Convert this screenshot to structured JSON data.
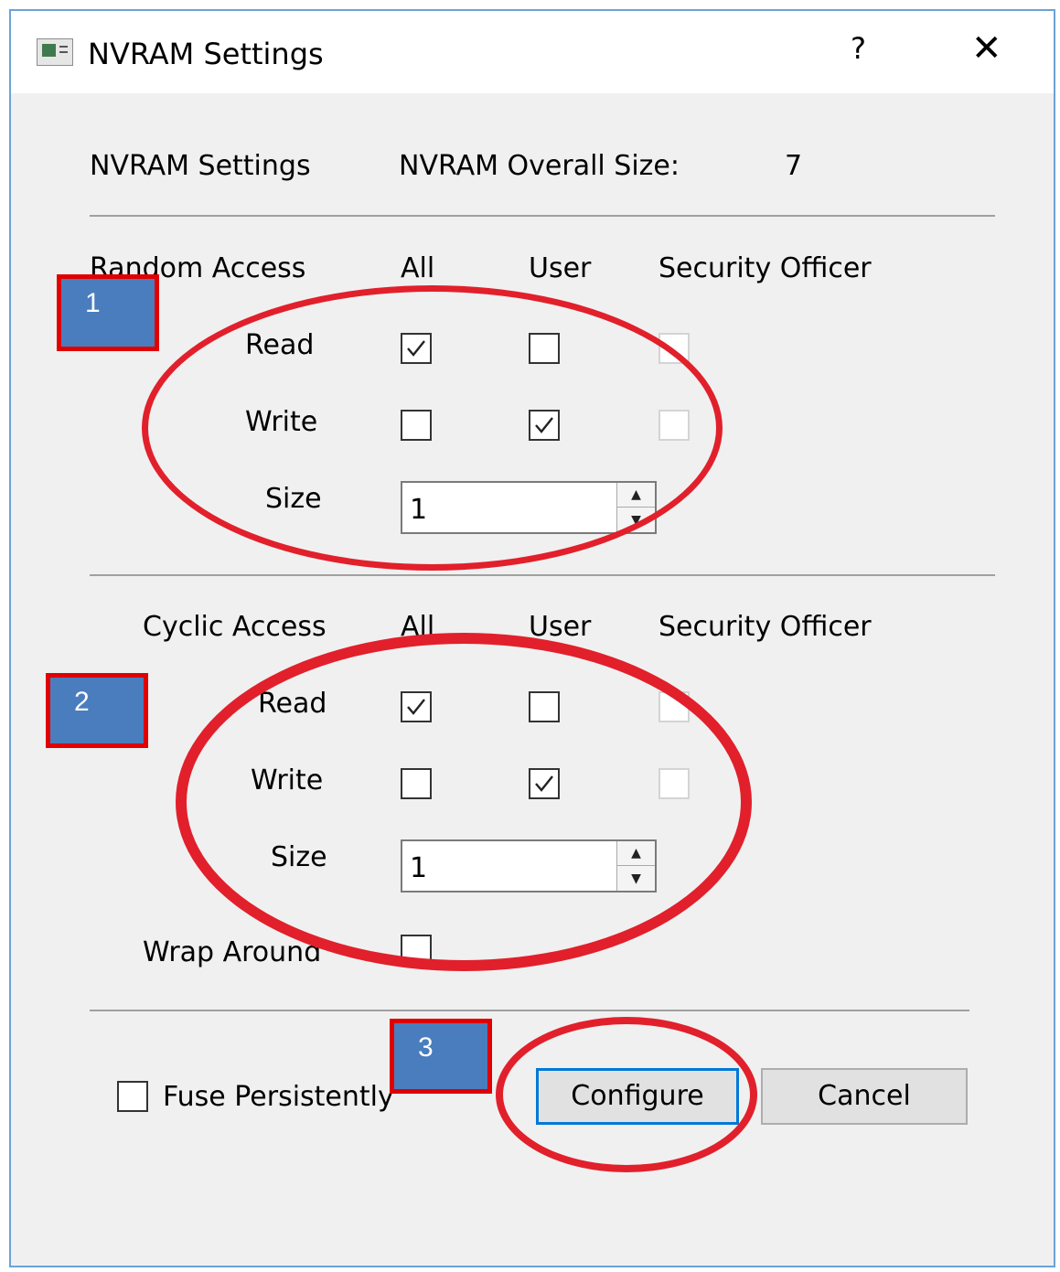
{
  "window": {
    "title": "NVRAM Settings",
    "help_icon": "?",
    "close_icon": "✕"
  },
  "header": {
    "settings_label": "NVRAM Settings",
    "overall_size_label": "NVRAM Overall Size:",
    "overall_size_value": "7"
  },
  "random_access": {
    "heading": "Random Access",
    "col_all": "All",
    "col_user": "User",
    "col_security_officer": "Security Officer",
    "read_label": "Read",
    "write_label": "Write",
    "size_label": "Size",
    "size_value": "1",
    "read": {
      "all": true,
      "user": false,
      "security_officer": false
    },
    "write": {
      "all": false,
      "user": true,
      "security_officer": false
    }
  },
  "cyclic_access": {
    "heading": "Cyclic Access",
    "col_all": "All",
    "col_user": "User",
    "col_security_officer": "Security Officer",
    "read_label": "Read",
    "write_label": "Write",
    "size_label": "Size",
    "size_value": "1",
    "wrap_around_label": "Wrap Around",
    "wrap_around": false,
    "read": {
      "all": true,
      "user": false,
      "security_officer": false
    },
    "write": {
      "all": false,
      "user": true,
      "security_officer": false
    }
  },
  "footer": {
    "fuse_persistently_label": "Fuse Persistently",
    "fuse_persistently": false,
    "configure_label": "Configure",
    "cancel_label": "Cancel"
  },
  "annotations": {
    "badge_1": "1",
    "badge_2": "2",
    "badge_3": "3",
    "highlight_color": "#e1202b",
    "badge_color": "#4a7dbd"
  },
  "icons": {
    "app": "window-app-icon",
    "help": "help-icon",
    "close": "close-icon",
    "spin_up": "▲",
    "spin_down": "▼"
  }
}
